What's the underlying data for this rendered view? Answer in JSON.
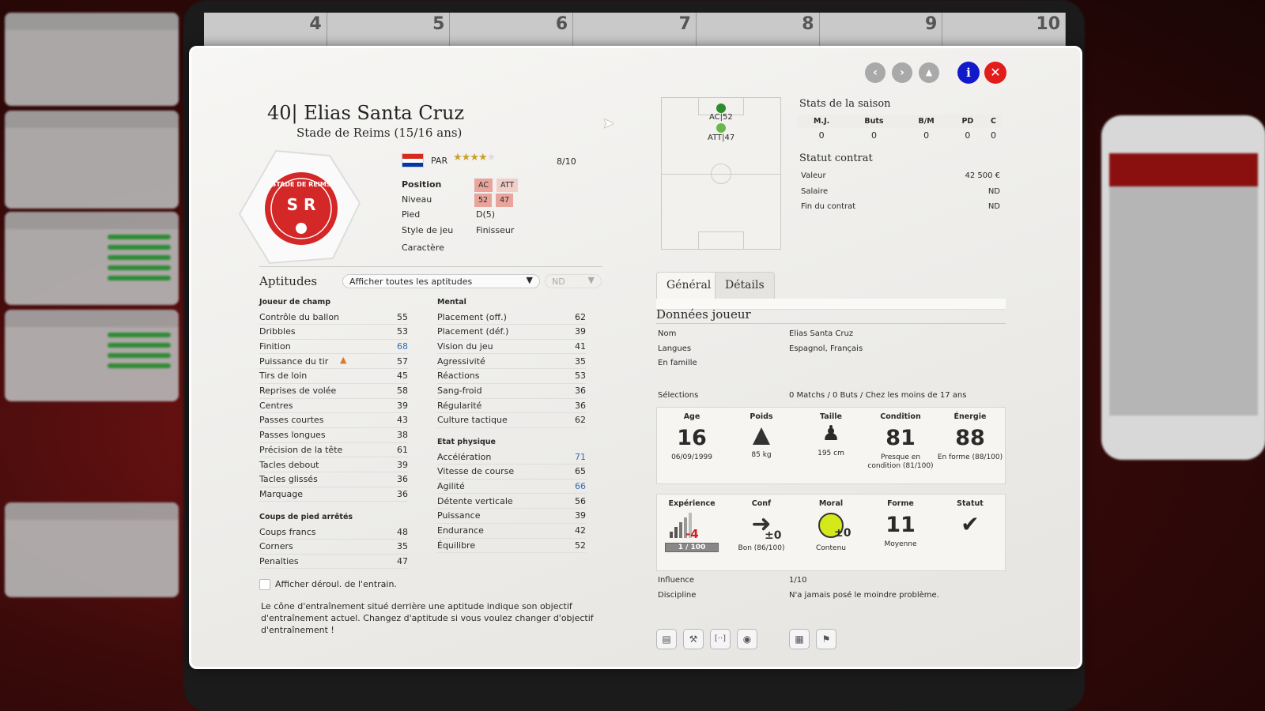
{
  "background": {
    "calendar": [
      "4",
      "5",
      "6",
      "7",
      "8",
      "9",
      "10"
    ]
  },
  "header": {
    "number": "40",
    "name": "Elias Santa Cruz",
    "club": "Stade de Reims (15/16 ans)",
    "nationality": "PAR",
    "rating_stars": 4,
    "rating_text": "8/10"
  },
  "crest": {
    "text_top": "STADE DE REIMS",
    "monogram": "S R"
  },
  "profile": {
    "position_label": "Position",
    "positions": [
      "AC",
      "ATT"
    ],
    "level_label": "Niveau",
    "levels": [
      "52",
      "47"
    ],
    "foot_label": "Pied",
    "foot": "D(5)",
    "style_label": "Style de jeu",
    "style": "Finisseur",
    "character_label": "Caractère",
    "character": ""
  },
  "aptitudes": {
    "title": "Aptitudes",
    "filter": "Afficher toutes les aptitudes",
    "filter2": "ND",
    "outfield_header": "Joueur de champ",
    "outfield": [
      {
        "label": "Contrôle du ballon",
        "value": "55",
        "hl": false
      },
      {
        "label": "Dribbles",
        "value": "53",
        "hl": false
      },
      {
        "label": "Finition",
        "value": "68",
        "hl": true
      },
      {
        "label": "Puissance du tir",
        "value": "57",
        "hl": false
      },
      {
        "label": "Tirs de loin",
        "value": "45",
        "hl": false
      },
      {
        "label": "Reprises de volée",
        "value": "58",
        "hl": false
      },
      {
        "label": "Centres",
        "value": "39",
        "hl": false
      },
      {
        "label": "Passes courtes",
        "value": "43",
        "hl": false
      },
      {
        "label": "Passes longues",
        "value": "38",
        "hl": false
      },
      {
        "label": "Précision de la tête",
        "value": "61",
        "hl": false
      },
      {
        "label": "Tacles debout",
        "value": "39",
        "hl": false
      },
      {
        "label": "Tacles glissés",
        "value": "36",
        "hl": false
      },
      {
        "label": "Marquage",
        "value": "36",
        "hl": false
      }
    ],
    "setpiece_header": "Coups de pied arrêtés",
    "setpiece": [
      {
        "label": "Coups francs",
        "value": "48"
      },
      {
        "label": "Corners",
        "value": "35"
      },
      {
        "label": "Penalties",
        "value": "47"
      }
    ],
    "mental_header": "Mental",
    "mental": [
      {
        "label": "Placement (off.)",
        "value": "62",
        "hl": false
      },
      {
        "label": "Placement (déf.)",
        "value": "39",
        "hl": false
      },
      {
        "label": "Vision du jeu",
        "value": "41",
        "hl": false
      },
      {
        "label": "Agressivité",
        "value": "35",
        "hl": false
      },
      {
        "label": "Réactions",
        "value": "53",
        "hl": false
      },
      {
        "label": "Sang-froid",
        "value": "36",
        "hl": false
      },
      {
        "label": "Régularité",
        "value": "36",
        "hl": false
      },
      {
        "label": "Culture tactique",
        "value": "62",
        "hl": false
      }
    ],
    "physical_header": "Etat physique",
    "physical": [
      {
        "label": "Accélération",
        "value": "71",
        "hl": true
      },
      {
        "label": "Vitesse de course",
        "value": "65",
        "hl": false
      },
      {
        "label": "Agilité",
        "value": "66",
        "hl": true
      },
      {
        "label": "Détente verticale",
        "value": "56",
        "hl": false
      },
      {
        "label": "Puissance",
        "value": "39",
        "hl": false
      },
      {
        "label": "Endurance",
        "value": "42",
        "hl": false
      },
      {
        "label": "Équilibre",
        "value": "52",
        "hl": false
      }
    ],
    "checkbox_label": "Afficher déroul. de l'entrain.",
    "note": "Le cône d'entraînement situé derrière une aptitude indique son objectif d'entraînement actuel. Changez d'aptitude si vous voulez changer d'objectif d'entraînement !"
  },
  "pitch": {
    "pos1": "AC|52",
    "pos2": "ATT|47"
  },
  "season": {
    "title": "Stats de la saison",
    "headers": [
      "M.J.",
      "Buts",
      "B/M",
      "PD",
      "C"
    ],
    "values": [
      "0",
      "0",
      "0",
      "0",
      "0"
    ]
  },
  "contract": {
    "title": "Statut contrat",
    "rows": [
      {
        "label": "Valeur",
        "value": "42 500 €"
      },
      {
        "label": "Salaire",
        "value": "ND"
      },
      {
        "label": "Fin du contrat",
        "value": "ND"
      }
    ]
  },
  "tabs": [
    "Général",
    "Détails"
  ],
  "player_data": {
    "title": "Données joueur",
    "rows": [
      {
        "label": "Nom",
        "value": "Elias Santa Cruz"
      },
      {
        "label": "Langues",
        "value": "Espagnol, Français"
      },
      {
        "label": "En famille",
        "value": ""
      }
    ],
    "selections_label": "Sélections",
    "selections": "0 Matchs / 0 Buts / Chez les moins de 17 ans"
  },
  "stats1": {
    "age_t": "Age",
    "age": "16",
    "age_sub": "06/09/1999",
    "weight_t": "Poids",
    "weight_sub": "85 kg",
    "height_t": "Taille",
    "height_sub": "195 cm",
    "cond_t": "Condition",
    "cond": "81",
    "cond_sub": "Presque en condition (81/100)",
    "energy_t": "Énergie",
    "energy": "88",
    "energy_sub": "En forme (88/100)"
  },
  "stats2": {
    "exp_t": "Expérience",
    "exp_delta": "-4",
    "exp_sub": "1 / 100",
    "conf_t": "Conf",
    "conf_delta": "±0",
    "conf_sub": "Bon (86/100)",
    "moral_t": "Moral",
    "moral_delta": "±0",
    "moral_sub": "Contenu",
    "forme_t": "Forme",
    "forme": "11",
    "forme_sub": "Moyenne",
    "statut_t": "Statut"
  },
  "extra": [
    {
      "label": "Influence",
      "value": "1/10"
    },
    {
      "label": "Discipline",
      "value": "N'a jamais posé le moindre problème."
    }
  ],
  "colors": {
    "accent_red": "#e21b1b",
    "info_blue": "#1219c8",
    "highlight": "#2d6fb8",
    "tag": "#e9a49b"
  }
}
